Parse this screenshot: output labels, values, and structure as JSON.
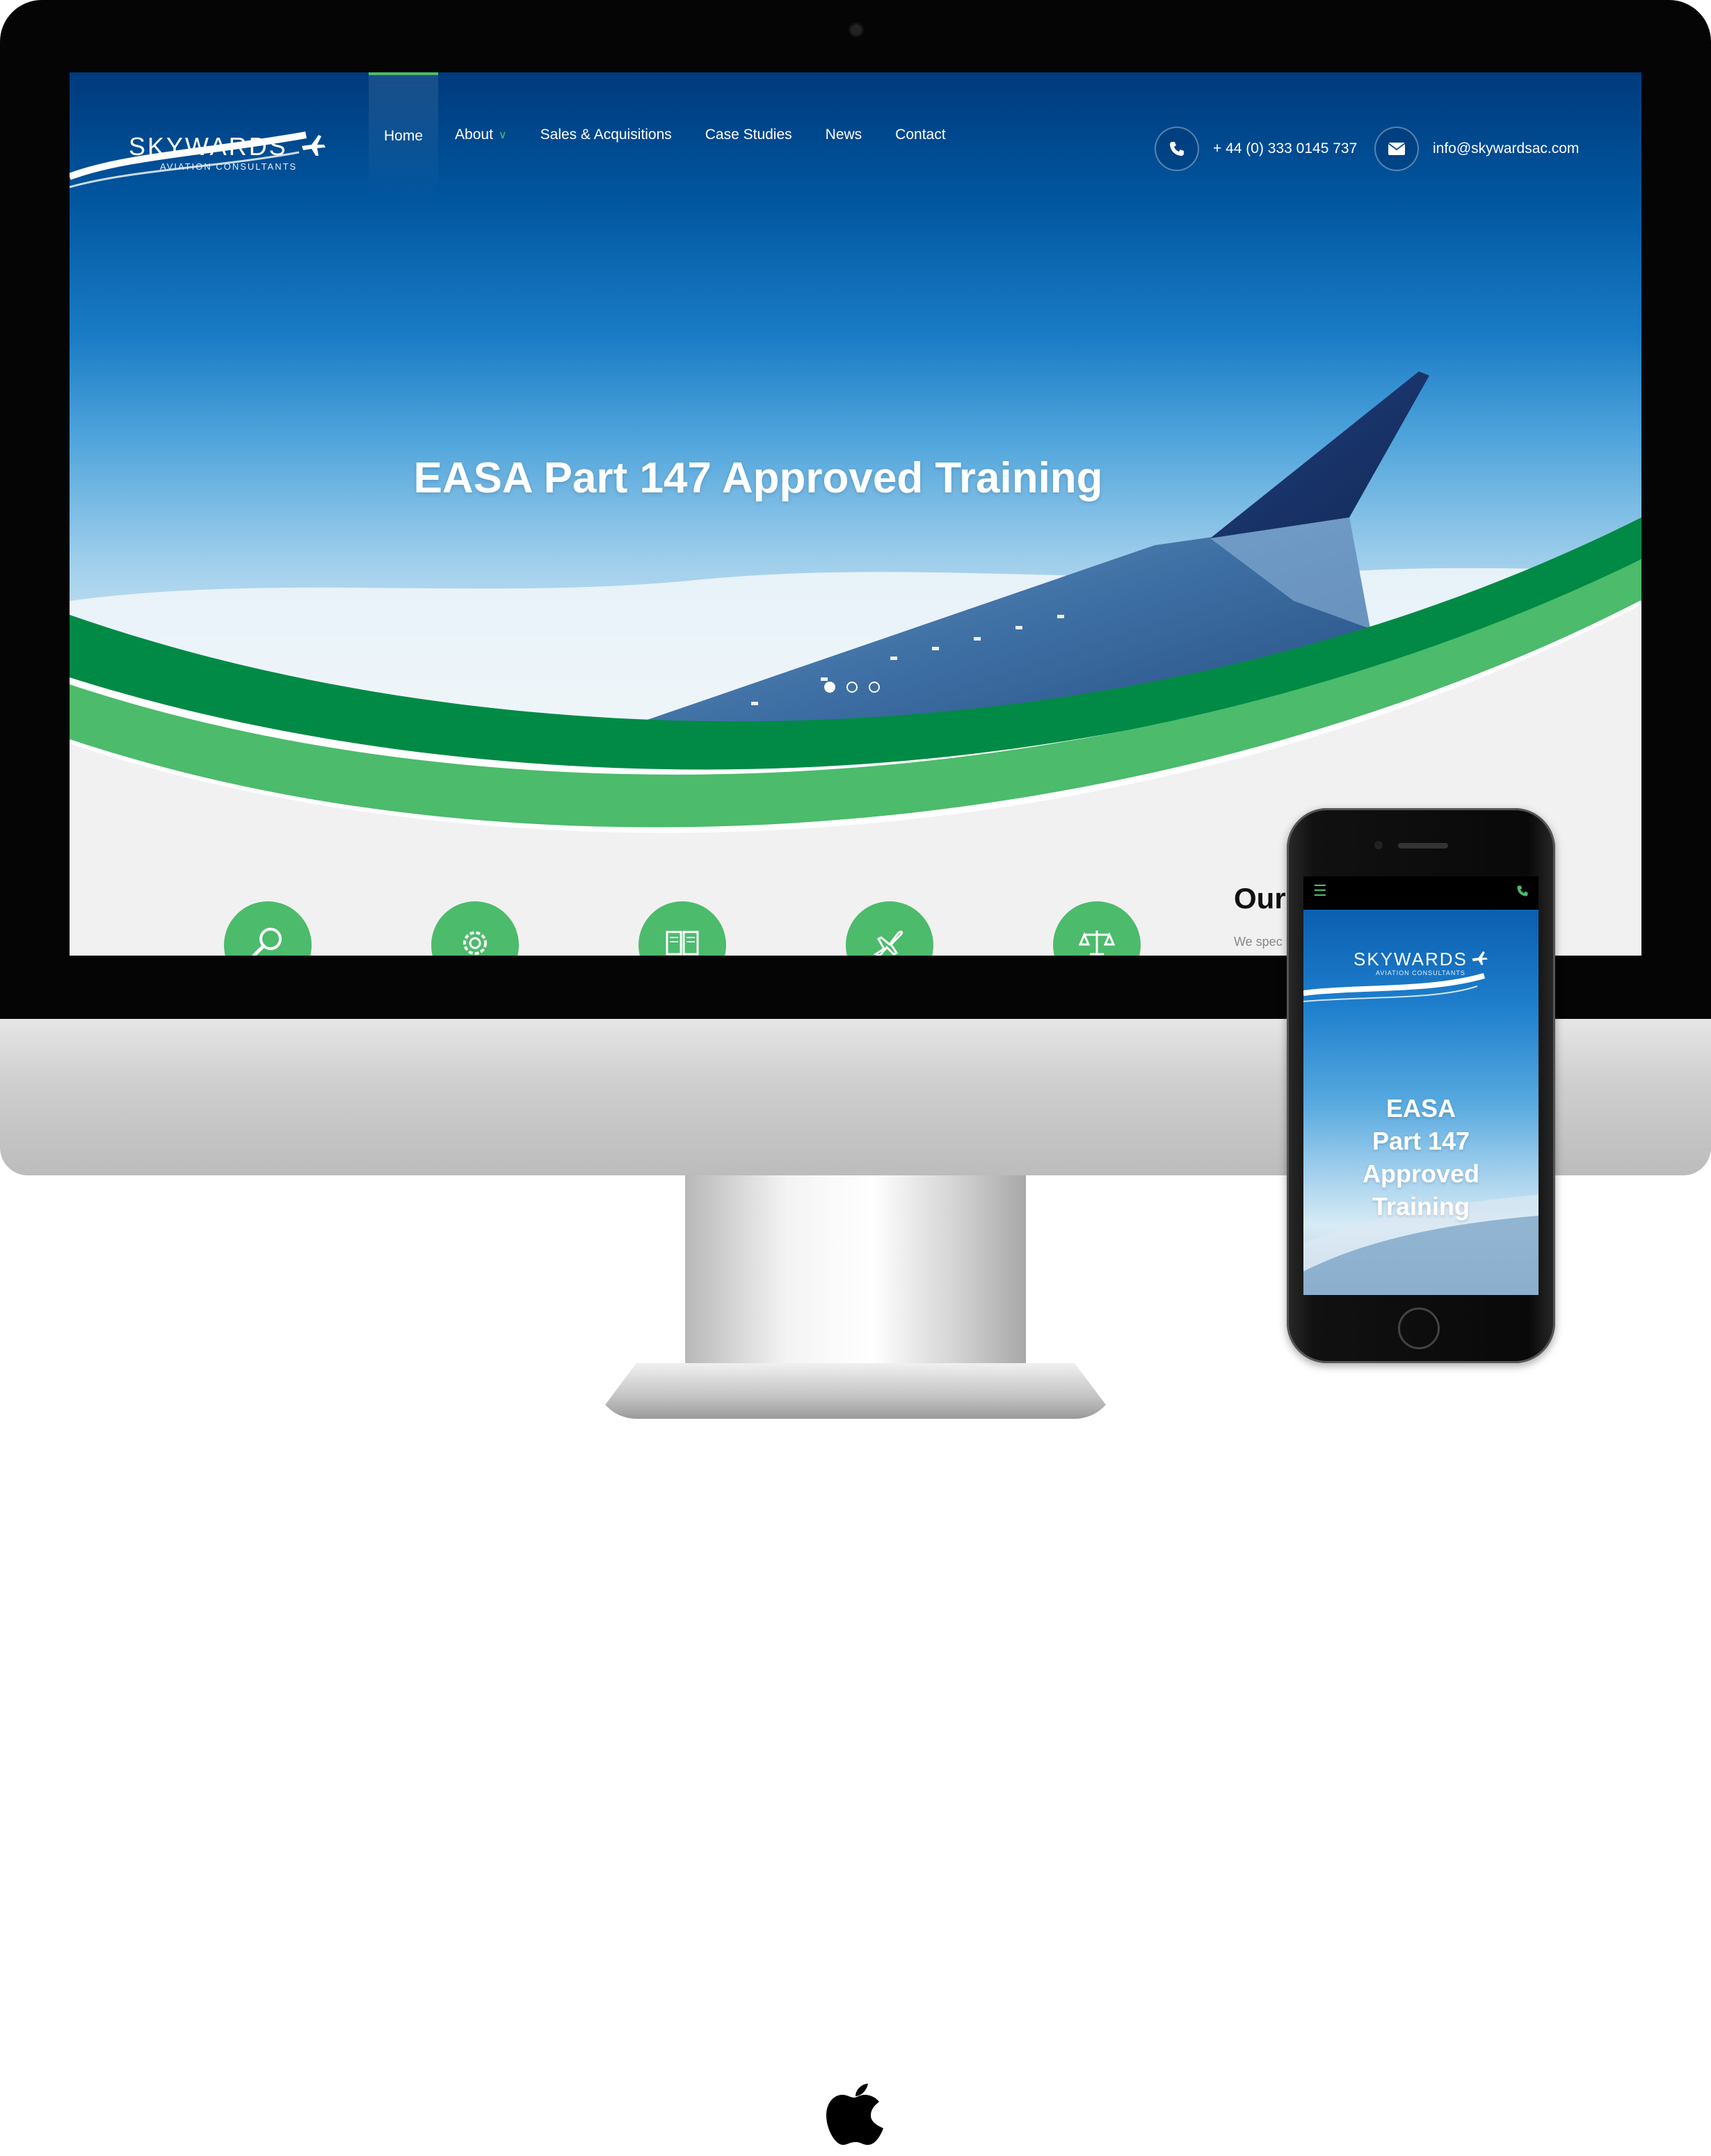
{
  "site": {
    "logo": {
      "name": "SKYWARDS",
      "tagline": "AVIATION CONSULTANTS"
    },
    "nav": [
      {
        "label": "Home",
        "active": true
      },
      {
        "label": "About",
        "has_dropdown": true
      },
      {
        "label": "Sales & Acquisitions"
      },
      {
        "label": "Case Studies"
      },
      {
        "label": "News"
      },
      {
        "label": "Contact"
      }
    ],
    "contact": {
      "phone": "+ 44 (0) 333 0145 737",
      "email": "info@skywardsac.com"
    },
    "hero": {
      "title": "EASA Part 147 Approved Training",
      "slides": 3,
      "active_slide": 1
    },
    "features": [
      {
        "icon": "search-icon"
      },
      {
        "icon": "gear-icon"
      },
      {
        "icon": "book-icon"
      },
      {
        "icon": "airplane-icon"
      },
      {
        "icon": "scales-icon"
      }
    ],
    "section": {
      "title": "Our",
      "text": "We spec"
    }
  },
  "mobile": {
    "logo": {
      "name": "SKYWARDS",
      "tagline": "AVIATION CONSULTANTS"
    },
    "hero_title": "EASA Part 147 Approved Training",
    "hero_lines": [
      "EASA",
      "Part 147",
      "Approved",
      "Training"
    ]
  },
  "colors": {
    "accent_green": "#4cbb6b",
    "dark_green": "#008a45",
    "sky_dark": "#003a7c",
    "page_bg": "#f1f1f1"
  }
}
